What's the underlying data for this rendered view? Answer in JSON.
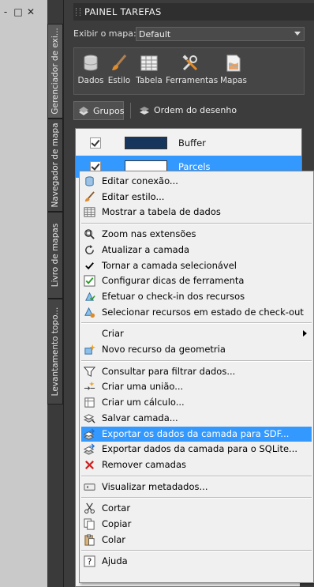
{
  "window_controls": [
    "-",
    "□",
    "✕"
  ],
  "side_tabs": [
    {
      "label": "Gerenciador de exi...",
      "active": true
    },
    {
      "label": "Navegador de mapa",
      "active": false
    },
    {
      "label": "Livro de mapas",
      "active": false
    },
    {
      "label": "Levantamento topo...",
      "active": false
    }
  ],
  "palette": {
    "title": "PAINEL TAREFAS",
    "map_label": "Exibir o mapa:",
    "map_value": "Default",
    "toolbar": [
      {
        "label": "Dados",
        "icon": "database-icon"
      },
      {
        "label": "Estilo",
        "icon": "brush-icon"
      },
      {
        "label": "Tabela",
        "icon": "table-icon"
      },
      {
        "label": "Ferramentas",
        "icon": "tools-icon"
      },
      {
        "label": "Mapas",
        "icon": "map-icon"
      }
    ],
    "groups_label": "Grupos",
    "order_label": "Ordem do desenho"
  },
  "layers": [
    {
      "name": "Buffer",
      "color": "#17365d",
      "checked": true,
      "selected": false
    },
    {
      "name": "Parcels",
      "color": "#ffffff",
      "checked": true,
      "selected": true
    }
  ],
  "context_menu": {
    "items": [
      {
        "label": "Editar conexão...",
        "icon": "database-connection-icon"
      },
      {
        "label": "Editar estilo...",
        "icon": "brush-icon"
      },
      {
        "label": "Mostrar a tabela de dados",
        "icon": "table-icon"
      },
      {
        "sep": true
      },
      {
        "label": "Zoom nas extensões",
        "icon": "zoom-extents-icon"
      },
      {
        "label": "Atualizar a camada",
        "icon": "refresh-icon"
      },
      {
        "label": "Tornar a camada selecionável",
        "icon": "check-icon"
      },
      {
        "label": "Configurar dicas de ferramenta",
        "icon": "tooltip-check-icon"
      },
      {
        "label": "Efetuar o check-in dos recursos",
        "icon": "check-in-icon"
      },
      {
        "label": "Selecionar recursos em estado de check-out",
        "icon": "check-out-select-icon"
      },
      {
        "sep": true
      },
      {
        "label": "Criar",
        "icon": "",
        "submenu": true
      },
      {
        "label": "Novo recurso da geometria",
        "icon": "new-feature-icon"
      },
      {
        "sep": true
      },
      {
        "label": "Consultar para filtrar dados...",
        "icon": "filter-icon"
      },
      {
        "label": "Criar uma união...",
        "icon": "join-icon"
      },
      {
        "label": "Criar um cálculo...",
        "icon": "calculator-icon"
      },
      {
        "label": "Salvar camada...",
        "icon": "save-layer-icon"
      },
      {
        "label": "Exportar os dados da camada para SDF...",
        "icon": "export-sdf-icon",
        "highlighted": true
      },
      {
        "label": "Exportar dados da camada para o SQLite...",
        "icon": "export-sqlite-icon"
      },
      {
        "label": "Remover camadas",
        "icon": "remove-icon"
      },
      {
        "sep": true
      },
      {
        "label": "Visualizar metadados...",
        "icon": "metadata-icon"
      },
      {
        "sep": true
      },
      {
        "label": "Cortar",
        "icon": "cut-icon"
      },
      {
        "label": "Copiar",
        "icon": "copy-icon"
      },
      {
        "label": "Colar",
        "icon": "paste-icon"
      },
      {
        "sep": true
      },
      {
        "label": "Ajuda",
        "icon": "help-icon"
      }
    ]
  }
}
